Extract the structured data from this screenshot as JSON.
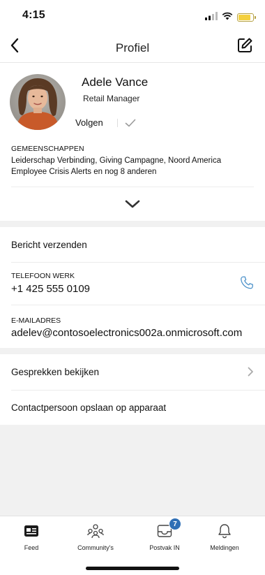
{
  "status_bar": {
    "time": "4:15",
    "battery_level": 0.85,
    "icons": [
      "cellular-signal-icon",
      "wifi-icon",
      "battery-icon"
    ]
  },
  "header": {
    "title": "Profiel",
    "back_icon": "chevron-left-icon",
    "edit_icon": "compose-icon"
  },
  "profile": {
    "name": "Adele Vance",
    "role": "Retail Manager",
    "follow_label": "Volgen",
    "communities_heading": "GEMEENSCHAPPEN",
    "communities_text": "Leiderschap Verbinding, Giving Campagne, Noord America Employee Crisis Alerts en nog 8 anderen"
  },
  "contact": {
    "send_message": "Bericht verzenden",
    "phone_label": "TELEFOON WERK",
    "phone_value": "+1 425 555 0109",
    "email_label": "E-MAILADRES",
    "email_value": "adelev@contosoelectronics002a.onmicrosoft.com"
  },
  "actions": {
    "view_conversations": "Gesprekken bekijken",
    "save_contact": "Contactpersoon opslaan op apparaat"
  },
  "tab_bar": {
    "tabs": [
      {
        "label": "Feed",
        "icon": "feed-icon"
      },
      {
        "label": "Community's",
        "icon": "communities-icon"
      },
      {
        "label": "Postvak IN",
        "icon": "inbox-icon",
        "badge": "7"
      },
      {
        "label": "Meldingen",
        "icon": "bell-icon"
      }
    ]
  },
  "colors": {
    "accent": "#2f6fb5",
    "phone_icon": "#4a90c9",
    "background": "#f1f1f1"
  }
}
